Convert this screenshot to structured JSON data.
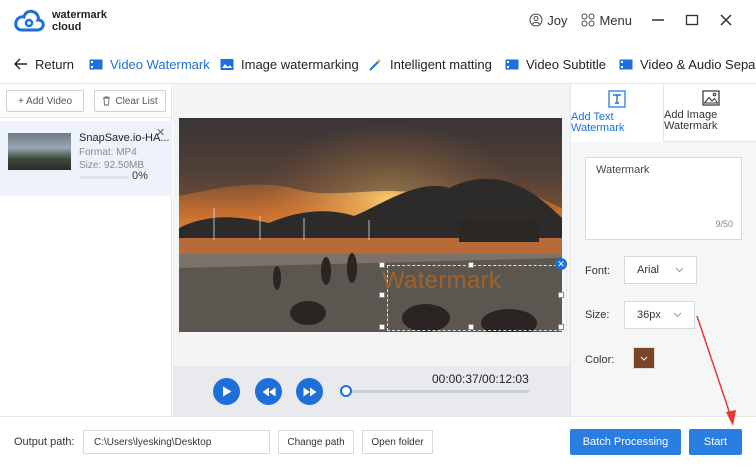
{
  "app": {
    "logo_line1": "watermark",
    "logo_line2": "cloud",
    "user_name": "Joy",
    "menu_label": "Menu",
    "brand_color": "#1e6fd9"
  },
  "tabs": [
    {
      "label": "Return",
      "icon": "arrow-left-icon"
    },
    {
      "label": "Video Watermark",
      "icon": "video-icon",
      "active": true
    },
    {
      "label": "Image watermarking",
      "icon": "image-icon"
    },
    {
      "label": "Intelligent matting",
      "icon": "magic-wand-icon"
    },
    {
      "label": "Video Subtitle",
      "icon": "video-icon"
    },
    {
      "label": "Video & Audio Sepa",
      "icon": "video-icon"
    }
  ],
  "filelist": {
    "add_video_label": "+ Add Video",
    "clear_list_label": "Clear List",
    "file": {
      "name": "SnapSave.io-HA...",
      "format": "Format:  MP4",
      "size": "Size:  92.50MB",
      "progress": "0%"
    }
  },
  "preview": {
    "watermark_text": "Watermark",
    "timecode": "00:00:37/00:12:03"
  },
  "settings": {
    "tab_text": "Add Text Watermark",
    "tab_image": "Add Image Watermark",
    "text_value": "Watermark",
    "counter": "9/50",
    "font_label": "Font:",
    "font_value": "Arial",
    "size_label": "Size:",
    "size_value": "36px",
    "color_label": "Color:",
    "color_value": "#7a4524"
  },
  "footer": {
    "output_label": "Output path:",
    "output_path": "C:\\Users\\lyesking\\Desktop",
    "change_path": "Change path",
    "open_folder": "Open folder",
    "batch_processing": "Batch Processing",
    "start": "Start"
  }
}
